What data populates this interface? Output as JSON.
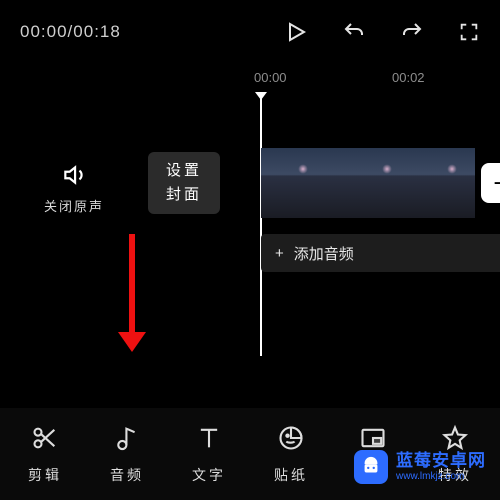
{
  "timecode": {
    "current": "00:00",
    "total": "00:18"
  },
  "ruler": {
    "ticks": [
      "00:00",
      "00:02"
    ]
  },
  "mute": {
    "label": "关闭原声"
  },
  "cover": {
    "line1": "设置",
    "line2": "封面"
  },
  "add_clip_glyph": "+",
  "add_audio": {
    "plus": "+",
    "label": "添加音频"
  },
  "tabs": {
    "edit": {
      "label": "剪辑"
    },
    "audio": {
      "label": "音频"
    },
    "text": {
      "label": "文字"
    },
    "sticker": {
      "label": "贴纸"
    },
    "pip": {
      "label": "画中"
    },
    "effect": {
      "label": "特效"
    }
  },
  "watermark": {
    "name": "蓝莓安卓网",
    "url": "www.lmkjz.com"
  },
  "colors": {
    "accent_red": "#d21",
    "brand_blue": "#2d6cff"
  }
}
